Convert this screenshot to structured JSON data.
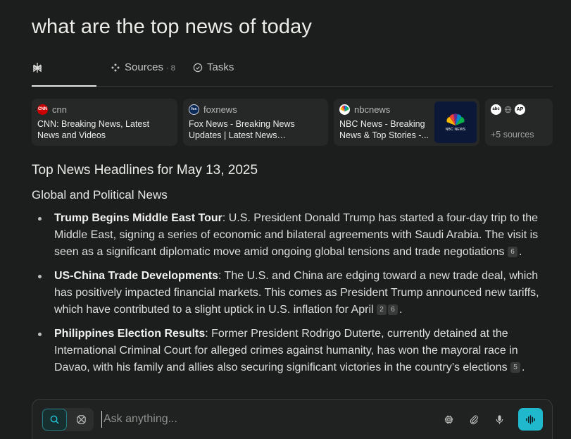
{
  "query": "what are the top news of today",
  "tabs": {
    "answer": {
      "icon": "perplexity-logo-icon"
    },
    "sources": {
      "label": "Sources",
      "count": "· 8",
      "icon": "sources-icon"
    },
    "tasks": {
      "label": "Tasks",
      "icon": "check-circle-icon"
    }
  },
  "sources": [
    {
      "site": "cnn",
      "title": "CNN: Breaking News, Latest News and Videos",
      "favicon_color": "#cc0000",
      "favicon_text": "CNN"
    },
    {
      "site": "foxnews",
      "title": "Fox News - Breaking News Updates | Latest News Headlines...",
      "favicon_color": "#0b2a5a",
      "favicon_text": "fox"
    },
    {
      "site": "nbcnews",
      "title": "NBC News - Breaking News & Top Stories -...",
      "favicon_color": "#ffffff",
      "thumb_text": "NBC NEWS"
    }
  ],
  "more_sources": {
    "label": "+5 sources",
    "icons": [
      "abc-icon",
      "globe-icon",
      "ap-icon"
    ],
    "abc_text": "abc",
    "ap_text": "AP"
  },
  "answer": {
    "heading": "Top News Headlines for May 13, 2025",
    "section": "Global and Political News",
    "items": [
      {
        "title": "Trump Begins Middle East Tour",
        "text": ": U.S. President Donald Trump has started a four-day trip to the Middle East, signing a series of economic and bilateral agreements with Saudi Arabia. The visit is seen as a significant diplomatic move amid ongoing global tensions and trade negotiations",
        "cites": [
          "6"
        ]
      },
      {
        "title": "US-China Trade Developments",
        "text": ": The U.S. and China are edging toward a new trade deal, which has positively impacted financial markets. This comes as President Trump announced new tariffs, which have contributed to a slight uptick in U.S. inflation for April",
        "cites": [
          "2",
          "6"
        ]
      },
      {
        "title": "Philippines Election Results",
        "text": ": Former President Rodrigo Duterte, currently detained at the International Criminal Court for alleged crimes against humanity, has won the mayoral race in Davao, with his family and allies also securing significant victories in the country’s elections",
        "cites": [
          "5"
        ]
      }
    ]
  },
  "ask": {
    "placeholder": "Ask anything..."
  },
  "colors": {
    "accent": "#1fb8cd",
    "background": "#1c1d1d",
    "card": "#262828"
  }
}
